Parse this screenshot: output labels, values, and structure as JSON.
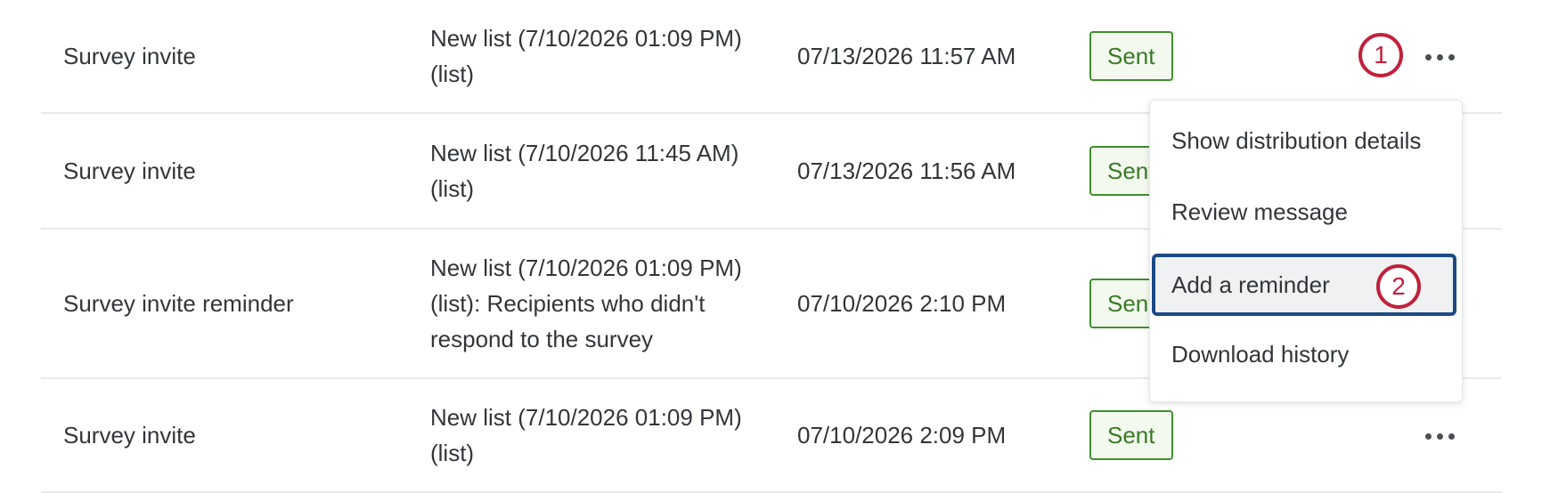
{
  "rows": [
    {
      "type": "Survey invite",
      "recipients": "New list (7/10/2026 01:09 PM) (list)",
      "date": "07/13/2026 11:57 AM",
      "status": "Sent"
    },
    {
      "type": "Survey invite",
      "recipients": "New list (7/10/2026 11:45 AM) (list)",
      "date": "07/13/2026 11:56 AM",
      "status": "Sent"
    },
    {
      "type": "Survey invite reminder",
      "recipients": "New list (7/10/2026 01:09 PM) (list): Recipients who didn't respond to the survey",
      "date": "07/10/2026 2:10 PM",
      "status": "Sent"
    },
    {
      "type": "Survey invite",
      "recipients": "New list (7/10/2026 01:09 PM) (list)",
      "date": "07/10/2026 2:09 PM",
      "status": "Sent"
    }
  ],
  "menu": {
    "items": [
      "Show distribution details",
      "Review message",
      "Add a reminder",
      "Download history"
    ]
  },
  "callouts": {
    "one": "1",
    "two": "2"
  },
  "icons": {
    "more": "more-options-icon"
  },
  "colors": {
    "sent_border": "#3f8f2c",
    "sent_text": "#3a7a25",
    "callout": "#c1203b",
    "highlight_border": "#1b4a86"
  }
}
